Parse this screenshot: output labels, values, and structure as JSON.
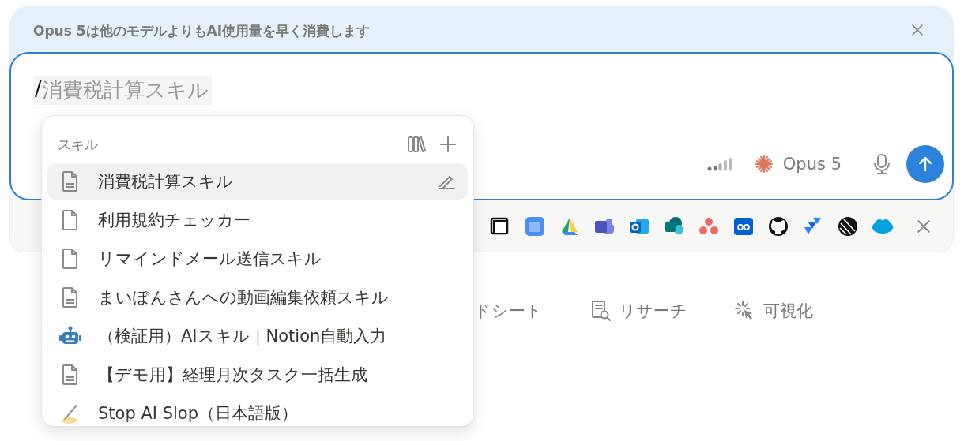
{
  "banner": {
    "text": "Opus 5は他のモデルよりもAI使用量を早く消費します"
  },
  "composer": {
    "command_prefix": "/",
    "query": "消費税計算スキル",
    "model": "Opus 5"
  },
  "suggestions": [
    {
      "label": "ドシート",
      "kind": "plain"
    },
    {
      "label": "リサーチ",
      "kind": "research"
    },
    {
      "label": "可視化",
      "kind": "visualize"
    }
  ],
  "skill_menu": {
    "title": "スキル",
    "items": [
      {
        "label": "消費税計算スキル",
        "kind": "page",
        "selected": true
      },
      {
        "label": "利用規約チェッカー",
        "kind": "blank",
        "selected": false
      },
      {
        "label": "リマインドメール送信スキル",
        "kind": "blank",
        "selected": false
      },
      {
        "label": "まいぽんさんへの動画編集依頼スキル",
        "kind": "page",
        "selected": false
      },
      {
        "label": "（検証用）AIスキル｜Notion自動入力",
        "kind": "bot",
        "selected": false
      },
      {
        "label": "【デモ用】経理月次タスク一括生成",
        "kind": "page",
        "selected": false
      },
      {
        "label": "Stop AI Slop（日本語版）",
        "kind": "draft",
        "selected": false
      }
    ]
  }
}
